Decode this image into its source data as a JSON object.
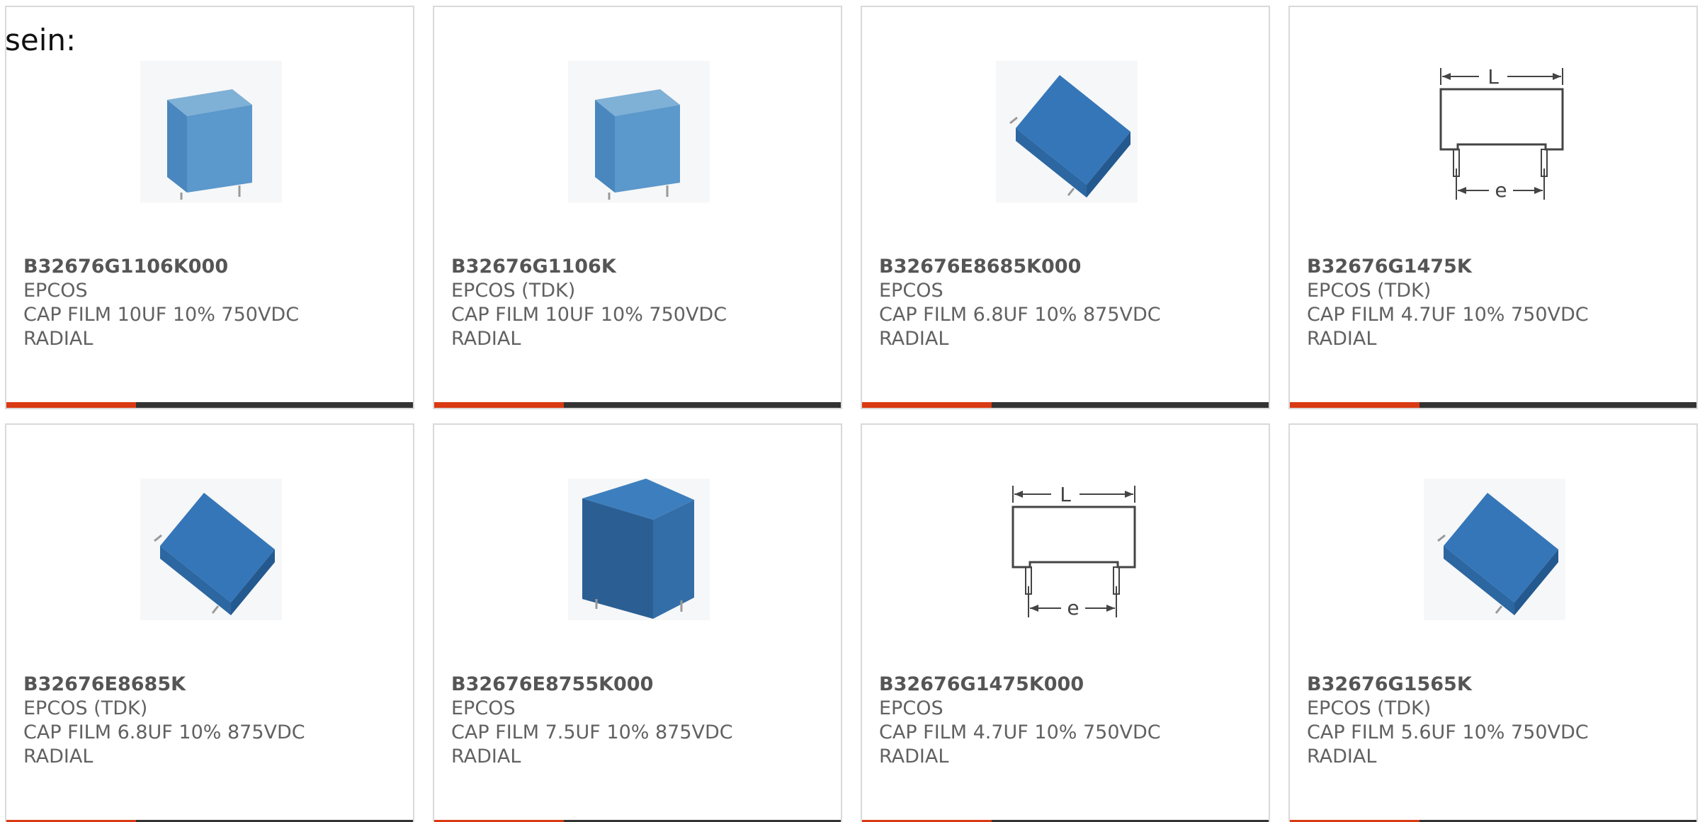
{
  "intro_text": "sein:",
  "accent_colors": {
    "primary": "#d93a13",
    "bar": "#333333",
    "product_blue": "#2f6fae"
  },
  "products": [
    {
      "part_number": "B32676G1106K000",
      "manufacturer": "EPCOS",
      "description": "CAP FILM 10UF 10% 750VDC",
      "package": "RADIAL",
      "image_icon": "capacitor-upright-icon"
    },
    {
      "part_number": "B32676G1106K",
      "manufacturer": "EPCOS (TDK)",
      "description": "CAP FILM 10UF 10% 750VDC",
      "package": "RADIAL",
      "image_icon": "capacitor-upright-icon"
    },
    {
      "part_number": "B32676E8685K000",
      "manufacturer": "EPCOS",
      "description": "CAP FILM 6.8UF 10% 875VDC",
      "package": "RADIAL",
      "image_icon": "capacitor-tilted-icon"
    },
    {
      "part_number": "B32676G1475K",
      "manufacturer": "EPCOS (TDK)",
      "description": "CAP FILM 4.7UF 10% 750VDC",
      "package": "RADIAL",
      "image_icon": "dimension-drawing-icon"
    },
    {
      "part_number": "B32676E8685K",
      "manufacturer": "EPCOS (TDK)",
      "description": "CAP FILM 6.8UF 10% 875VDC",
      "package": "RADIAL",
      "image_icon": "capacitor-tilted-icon"
    },
    {
      "part_number": "B32676E8755K000",
      "manufacturer": "EPCOS",
      "description": "CAP FILM 7.5UF 10% 875VDC",
      "package": "RADIAL",
      "image_icon": "capacitor-box-icon"
    },
    {
      "part_number": "B32676G1475K000",
      "manufacturer": "EPCOS",
      "description": "CAP FILM 4.7UF 10% 750VDC",
      "package": "RADIAL",
      "image_icon": "dimension-drawing-icon"
    },
    {
      "part_number": "B32676G1565K",
      "manufacturer": "EPCOS (TDK)",
      "description": "CAP FILM 5.6UF 10% 750VDC",
      "package": "RADIAL",
      "image_icon": "capacitor-tilted-icon"
    }
  ],
  "dimension_labels": {
    "length": "L",
    "pitch": "e"
  }
}
